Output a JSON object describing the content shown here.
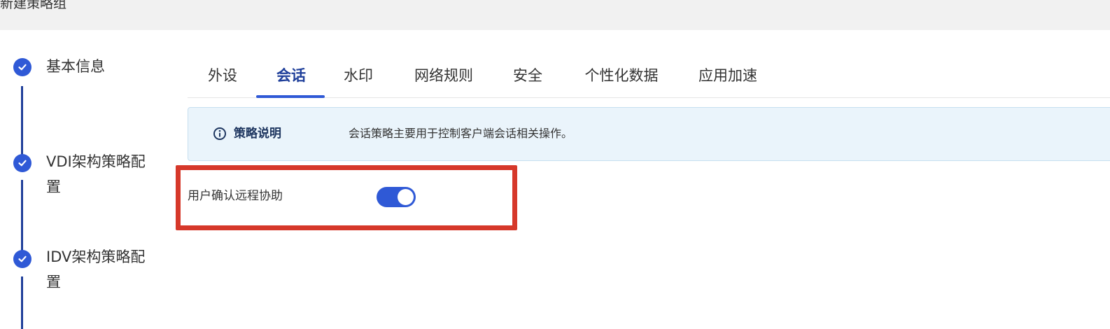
{
  "header": {
    "title": "新建策略组"
  },
  "steps": [
    {
      "label": "基本信息",
      "state": "done"
    },
    {
      "label": "VDI架构策略配置",
      "state": "done"
    },
    {
      "label": "IDV架构策略配置",
      "state": "done"
    }
  ],
  "tabs": [
    {
      "label": "外设",
      "active": false
    },
    {
      "label": "会话",
      "active": true
    },
    {
      "label": "水印",
      "active": false
    },
    {
      "label": "网络规则",
      "active": false
    },
    {
      "label": "安全",
      "active": false
    },
    {
      "label": "个性化数据",
      "active": false
    },
    {
      "label": "应用加速",
      "active": false
    }
  ],
  "info": {
    "icon": "info-circle-icon",
    "title": "策略说明",
    "text": "会话策略主要用于控制客户端会话相关操作。"
  },
  "settings": [
    {
      "label": "用户确认远程协助",
      "enabled": true
    }
  ],
  "colors": {
    "accent": "#2f59d6",
    "highlight_border": "#d6382a",
    "banner_bg": "#eaf4fb"
  }
}
